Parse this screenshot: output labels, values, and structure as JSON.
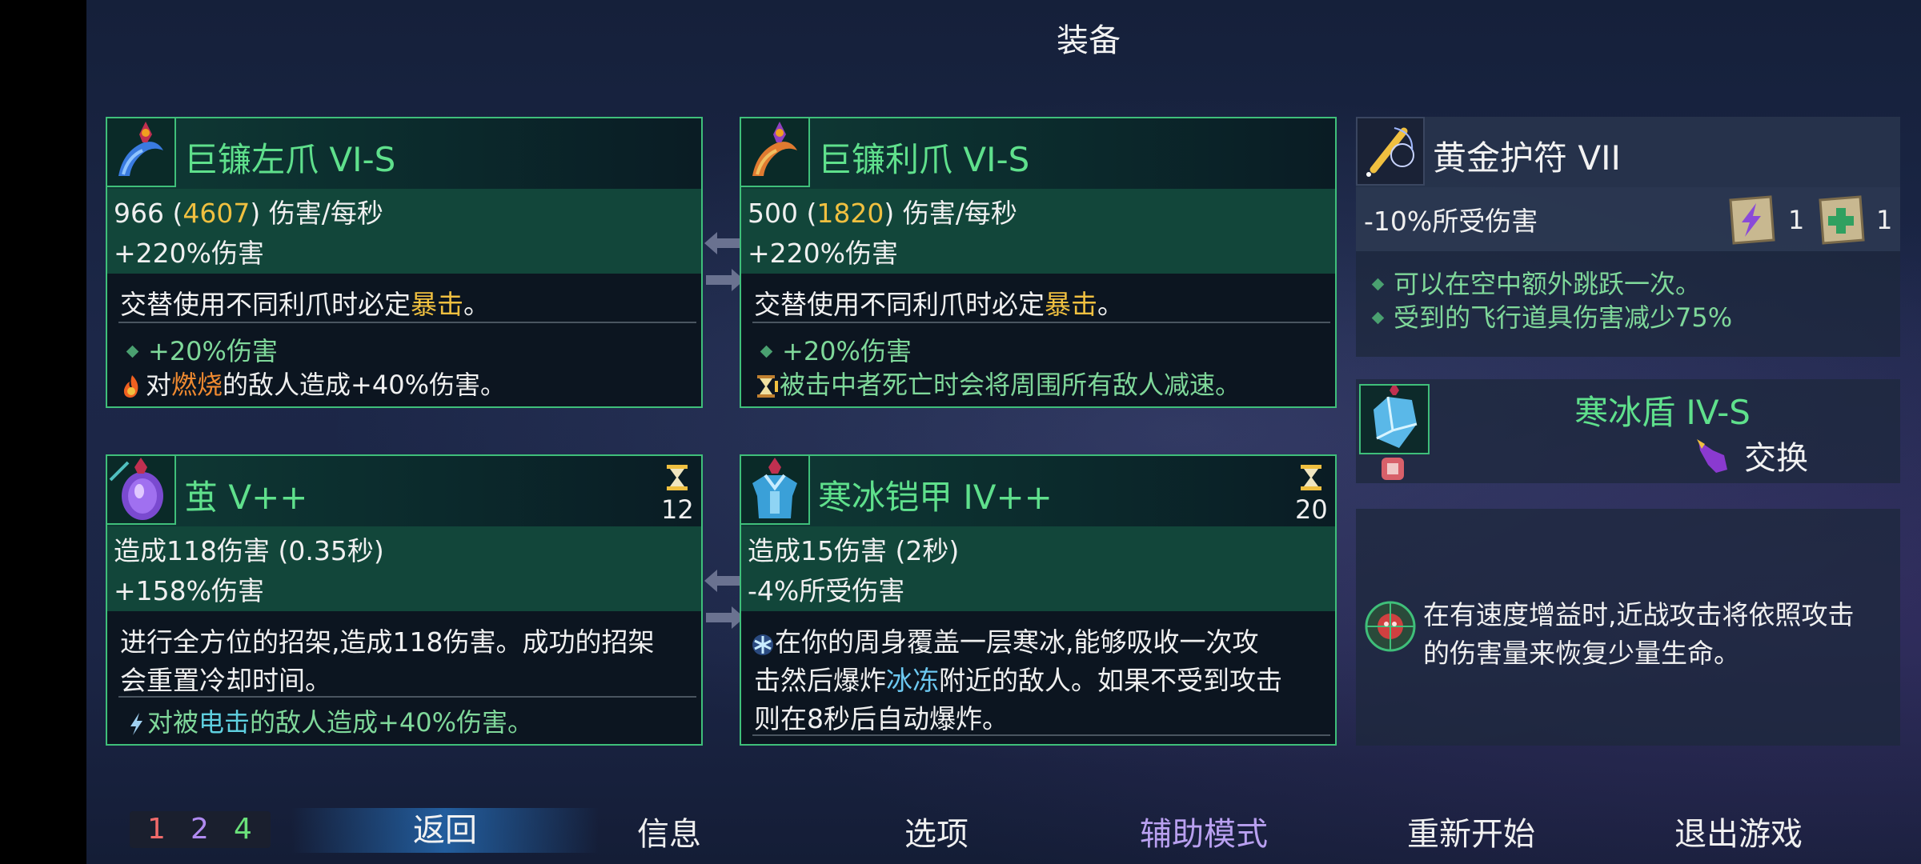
{
  "screen_title": "装备",
  "weapons": [
    {
      "name": "巨镰左爪 VI-S",
      "dps_base": "966",
      "dps_crit": "4607",
      "dps_open": " (",
      "dps_close": ") 伤害/每秒",
      "damage_bonus": "+220%伤害",
      "desc_pre": "交替使用不同利爪时必定",
      "desc_key": "暴击",
      "desc_post": "。",
      "affix1": "+20%伤害",
      "affix2_pre": "对",
      "affix2_key": "燃烧",
      "affix2_post": "的敌人造成+40%伤害。"
    },
    {
      "name": "巨镰利爪 VI-S",
      "dps_base": "500",
      "dps_crit": "1820",
      "dps_open": " (",
      "dps_close": ") 伤害/每秒",
      "damage_bonus": "+220%伤害",
      "desc_pre": "交替使用不同利爪时必定",
      "desc_key": "暴击",
      "desc_post": "。",
      "affix1": "+20%伤害",
      "affix2": "被击中者死亡时会将周围所有敌人减速。"
    }
  ],
  "skills": [
    {
      "name": "茧 V++",
      "cooldown": "12",
      "damage": "造成118伤害 (0.35秒)",
      "damage_bonus": "+158%伤害",
      "desc_line1": "进行全方位的招架,造成118伤害。成功的招架",
      "desc_line2": "会重置冷却时间。",
      "affix_pre": "对被",
      "affix_key": "电击",
      "affix_post": "的敌人造成+40%伤害。"
    },
    {
      "name": "寒冰铠甲 IV++",
      "cooldown": "20",
      "damage": "造成15伤害 (2秒)",
      "damage_bonus": "-4%所受伤害",
      "desc_line1": "在你的周身覆盖一层寒冰,能够吸收一次攻",
      "desc_line2_pre": "击然后爆炸",
      "desc_line2_key": "冰冻",
      "desc_line2_post": "附近的敌人。如果不受到攻击",
      "desc_line3": "则在8秒后自动爆炸。"
    }
  ],
  "amulet": {
    "name": "黄金护符 VII",
    "stat": "-10%所受伤害",
    "scroll1_count": "1",
    "scroll2_count": "1",
    "bonus1": "可以在空中额外跳跃一次。",
    "bonus2": "受到的飞行道具伤害减少75%"
  },
  "shield": {
    "name": "寒冰盾 IV-S",
    "swap_label": "交换"
  },
  "mutation": {
    "line1": "在有速度增益时,近战攻击将依照攻击",
    "line2": "的伤害量来恢复少量生命。"
  },
  "bottom_bar": {
    "stats": [
      "1",
      "2",
      "4"
    ],
    "back": "返回",
    "info": "信息",
    "options": "选项",
    "assist": "辅助模式",
    "restart": "重新开始",
    "quit": "退出游戏"
  },
  "colors": {
    "card_border": "#3fbf7a",
    "item_name": "#5fe08c",
    "gold_value": "#f0c040",
    "burn": "#f08a30",
    "freeze": "#6cc8f0",
    "assist_mode": "#b9a0f0",
    "brutality": "#f06a6a",
    "tactics": "#b08af0",
    "survival": "#6ae07a"
  },
  "icons": {
    "weapon1": "left-scythe-claw-icon",
    "weapon2": "scythe-claw-icon",
    "skill1": "cocoon-icon",
    "skill2": "ice-armor-icon",
    "amulet": "amulet-icon",
    "shield": "ice-shield-icon",
    "mutation": "mutation-icon",
    "cooldown": "hourglass-icon"
  }
}
